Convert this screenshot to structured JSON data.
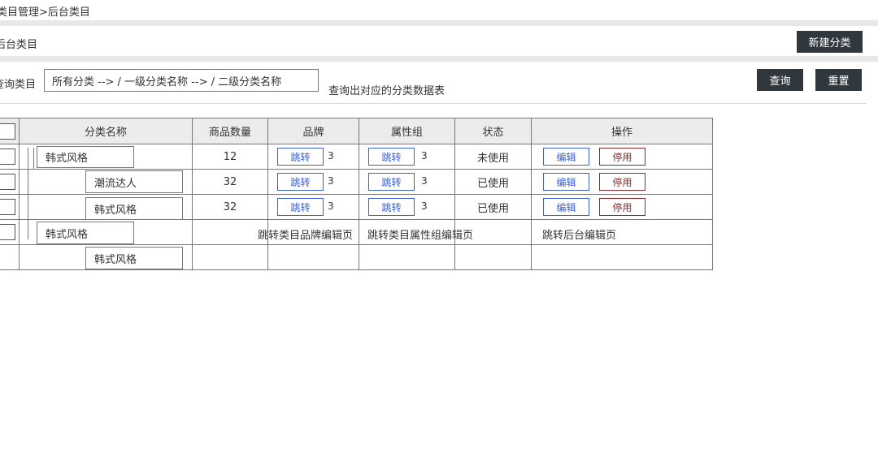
{
  "breadcrumb": "类目管理>后台类目",
  "section_title": "后台类目",
  "new_button": "新建分类",
  "query": {
    "label": "查询类目",
    "select_value": "所有分类 --> / 一级分类名称 --> /  二级分类名称",
    "hint": "查询出对应的分类数据表",
    "search_button": "查询",
    "reset_button": "重置"
  },
  "table": {
    "headers": [
      "分类名称",
      "商品数量",
      "品牌",
      "属性组",
      "状态",
      "操作"
    ],
    "rows": [
      {
        "name": "韩式风格",
        "count": "12",
        "jump": "跳转",
        "brand_count": "3",
        "attr_count": "3",
        "status": "未使用",
        "edit": "编辑",
        "stop": "停用"
      },
      {
        "name": "潮流达人",
        "count": "32",
        "jump": "跳转",
        "brand_count": "3",
        "attr_count": "3",
        "status": "已使用",
        "edit": "编辑",
        "stop": "停用"
      },
      {
        "name": "韩式风格",
        "count": "32",
        "jump": "跳转",
        "brand_count": "3",
        "attr_count": "3",
        "status": "已使用",
        "edit": "编辑",
        "stop": "停用"
      },
      {
        "name": "韩式风格"
      },
      {
        "name": "韩式风格"
      }
    ],
    "notes": {
      "brand": "跳转类目品牌编辑页",
      "attr": "跳转类目属性组编辑页",
      "ops": "跳转后台编辑页"
    }
  }
}
